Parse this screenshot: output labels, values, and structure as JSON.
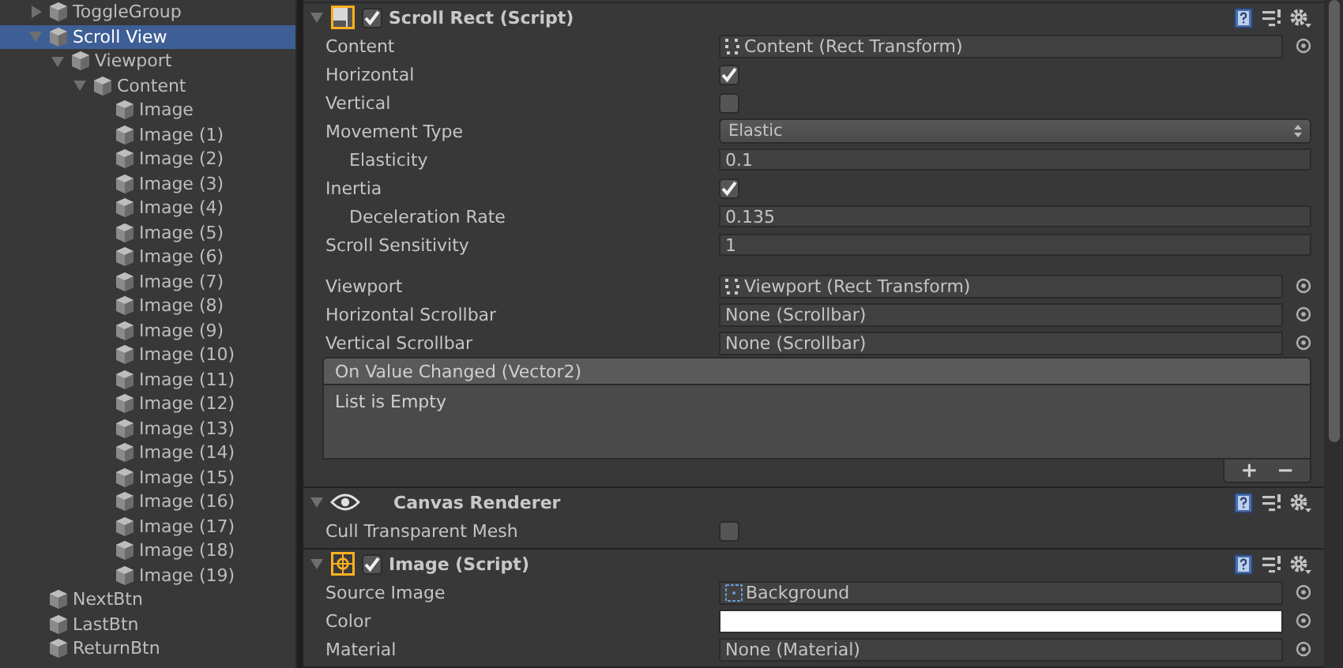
{
  "hierarchy": {
    "items": [
      {
        "label": "ToggleGroup",
        "expanded": false,
        "selected": false
      },
      {
        "label": "Scroll View",
        "expanded": true,
        "selected": true,
        "children": [
          {
            "label": "Viewport",
            "expanded": true,
            "selected": false,
            "children": [
              {
                "label": "Content",
                "expanded": true,
                "selected": false,
                "children": [
                  {
                    "label": "Image",
                    "selected": false
                  },
                  {
                    "label": "Image (1)",
                    "selected": false
                  },
                  {
                    "label": "Image (2)",
                    "selected": false
                  },
                  {
                    "label": "Image (3)",
                    "selected": false
                  },
                  {
                    "label": "Image (4)",
                    "selected": false
                  },
                  {
                    "label": "Image (5)",
                    "selected": false
                  },
                  {
                    "label": "Image (6)",
                    "selected": false
                  },
                  {
                    "label": "Image (7)",
                    "selected": false
                  },
                  {
                    "label": "Image (8)",
                    "selected": false
                  },
                  {
                    "label": "Image (9)",
                    "selected": false
                  },
                  {
                    "label": "Image (10)",
                    "selected": false
                  },
                  {
                    "label": "Image (11)",
                    "selected": false
                  },
                  {
                    "label": "Image (12)",
                    "selected": false
                  },
                  {
                    "label": "Image (13)",
                    "selected": false
                  },
                  {
                    "label": "Image (14)",
                    "selected": false
                  },
                  {
                    "label": "Image (15)",
                    "selected": false
                  },
                  {
                    "label": "Image (16)",
                    "selected": false
                  },
                  {
                    "label": "Image (17)",
                    "selected": false
                  },
                  {
                    "label": "Image (18)",
                    "selected": false
                  },
                  {
                    "label": "Image (19)",
                    "selected": false
                  }
                ]
              }
            ]
          }
        ]
      },
      {
        "label": "NextBtn",
        "selected": false
      },
      {
        "label": "LastBtn",
        "selected": false
      },
      {
        "label": "ReturnBtn",
        "selected": false
      }
    ]
  },
  "inspector": {
    "components": [
      {
        "title": "Scroll Rect (Script)",
        "kind": "script",
        "enabled": true,
        "groups": [
          {
            "properties": [
              {
                "label": "Content",
                "kind": "transform-ref",
                "value": "Content (Rect Transform)",
                "sub": false
              },
              {
                "label": "Horizontal",
                "kind": "checkbox",
                "checked": true,
                "sub": false
              },
              {
                "label": "Vertical",
                "kind": "checkbox",
                "checked": false,
                "sub": false
              },
              {
                "label": "Movement Type",
                "kind": "dropdown",
                "value": "Elastic",
                "sub": false
              },
              {
                "label": "Elasticity",
                "kind": "text",
                "value": "0.1",
                "sub": true
              },
              {
                "label": "Inertia",
                "kind": "checkbox",
                "checked": true,
                "sub": false
              },
              {
                "label": "Deceleration Rate",
                "kind": "text",
                "value": "0.135",
                "sub": true
              },
              {
                "label": "Scroll Sensitivity",
                "kind": "text",
                "value": "1",
                "sub": false
              }
            ]
          },
          {
            "properties": [
              {
                "label": "Viewport",
                "kind": "transform-ref",
                "value": "Viewport (Rect Transform)",
                "sub": false
              },
              {
                "label": "Horizontal Scrollbar",
                "kind": "object",
                "value": "None (Scrollbar)",
                "sub": false
              },
              {
                "label": "Vertical Scrollbar",
                "kind": "object",
                "value": "None (Scrollbar)",
                "sub": false
              }
            ]
          }
        ],
        "event": {
          "title": "On Value Changed (Vector2)",
          "body": "List is Empty",
          "add": "+",
          "remove": "−"
        }
      },
      {
        "title": "Canvas Renderer",
        "kind": "renderer",
        "groups": [
          {
            "properties": [
              {
                "label": "Cull Transparent Mesh",
                "kind": "checkbox",
                "checked": false,
                "sub": false
              }
            ]
          }
        ]
      },
      {
        "title": "Image (Script)",
        "kind": "image",
        "enabled": true,
        "groups": [
          {
            "properties": [
              {
                "label": "Source Image",
                "kind": "sprite-ref",
                "value": "Background",
                "sub": false
              },
              {
                "label": "Color",
                "kind": "color",
                "color": "#ffffff",
                "sub": false
              },
              {
                "label": "Material",
                "kind": "object",
                "value": "None (Material)",
                "sub": false
              }
            ]
          }
        ]
      }
    ]
  }
}
